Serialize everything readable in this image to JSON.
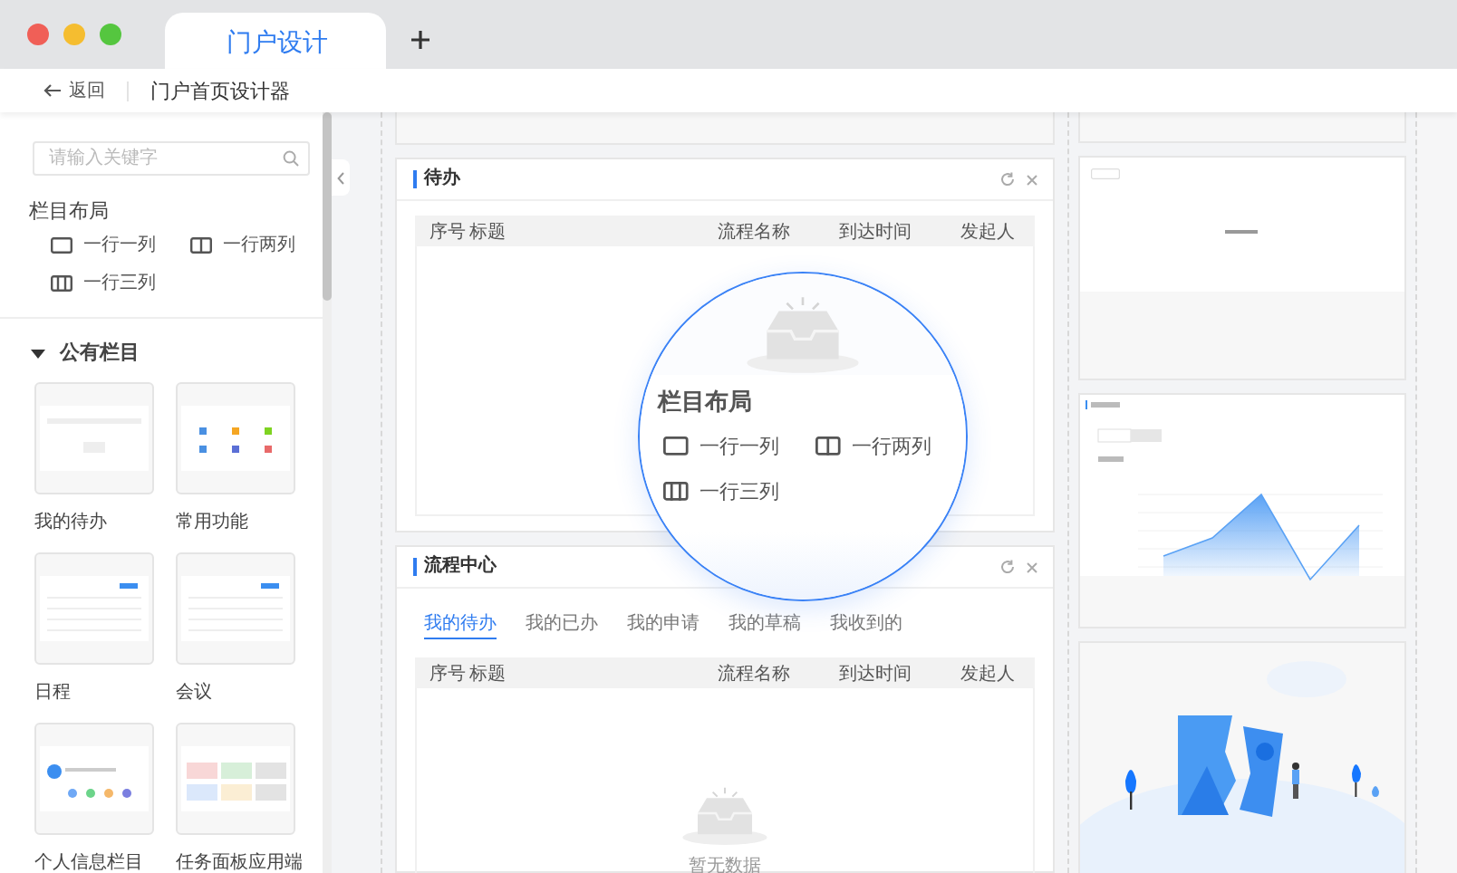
{
  "window": {
    "tabs": [
      {
        "label": "门户设计",
        "selected": true
      }
    ]
  },
  "header": {
    "back_label": "返回",
    "page_title": "门户首页设计器"
  },
  "sidebar": {
    "search": {
      "placeholder": "请输入关键字"
    },
    "layout_section": {
      "title": "栏目布局",
      "options": [
        {
          "kind": "one-column",
          "label": "一行一列"
        },
        {
          "kind": "two-column",
          "label": "一行两列"
        },
        {
          "kind": "three-column",
          "label": "一行三列"
        }
      ]
    },
    "public_section": {
      "title": "公有栏目",
      "expanded": true,
      "widgets": [
        {
          "kind": "table",
          "label": "我的待办"
        },
        {
          "kind": "icons",
          "label": "常用功能"
        },
        {
          "kind": "calendar",
          "label": "日程"
        },
        {
          "kind": "schedule",
          "label": "会议"
        },
        {
          "kind": "profile",
          "label": "个人信息栏目"
        },
        {
          "kind": "board",
          "label": "任务面板应用端"
        }
      ]
    }
  },
  "canvas": {
    "main_column": [
      {
        "kind": "blank"
      },
      {
        "kind": "table",
        "title": "待办",
        "columns": [
          "序号",
          "标题",
          "流程名称",
          "到达时间",
          "发起人"
        ]
      },
      {
        "kind": "tabbed-table",
        "title": "流程中心",
        "tabs": [
          {
            "label": "我的待办",
            "selected": true
          },
          {
            "label": "我的已办",
            "selected": false
          },
          {
            "label": "我的申请",
            "selected": false
          },
          {
            "label": "我的草稿",
            "selected": false
          },
          {
            "label": "我收到的",
            "selected": false
          }
        ],
        "columns": [
          "序号",
          "标题",
          "流程名称",
          "到达时间",
          "发起人"
        ],
        "empty_text": "暂无数据"
      }
    ],
    "side_column": [
      {
        "kind": "blank"
      },
      {
        "kind": "empty"
      },
      {
        "kind": "chart"
      },
      {
        "kind": "illustration"
      }
    ]
  },
  "magnifier": {
    "title": "栏目布局",
    "options": [
      {
        "kind": "one-column",
        "label": "一行一列"
      },
      {
        "kind": "two-column",
        "label": "一行两列"
      },
      {
        "kind": "three-column",
        "label": "一行三列"
      }
    ]
  }
}
